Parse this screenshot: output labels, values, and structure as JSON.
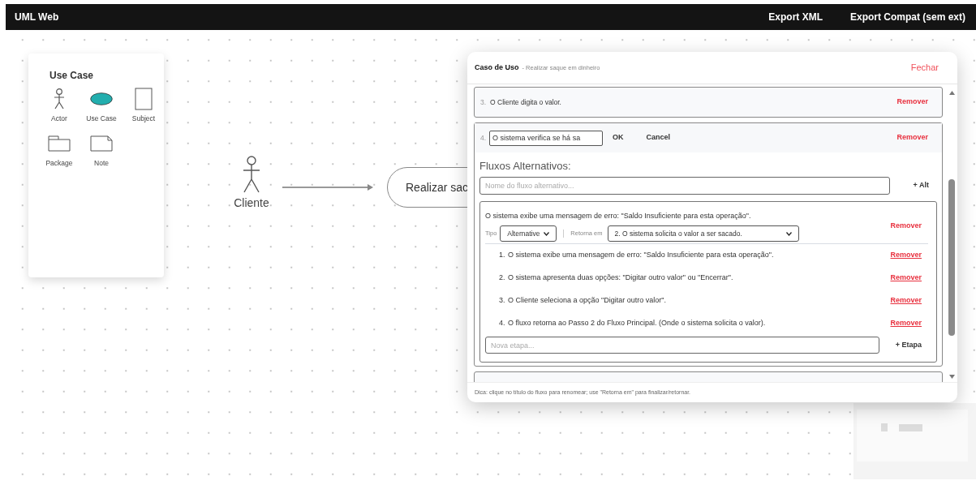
{
  "app": {
    "title": "UML Web",
    "actions": [
      "Export XML",
      "Export Compat (sem ext)"
    ]
  },
  "palette": {
    "title": "Use Case",
    "tools": [
      {
        "kind": "actor",
        "label": "Actor"
      },
      {
        "kind": "usecase",
        "label": "Use Case"
      },
      {
        "kind": "subject",
        "label": "Subject"
      },
      {
        "kind": "package",
        "label": "Package"
      },
      {
        "kind": "note",
        "label": "Note"
      }
    ]
  },
  "diagram": {
    "actor": {
      "label": "Cliente"
    },
    "use_case": {
      "label": "Realizar sac"
    }
  },
  "dialog": {
    "title": "Caso de Uso",
    "subtitle": "- Realizar saque em dinheiro",
    "close": "Fechar",
    "steps": [
      {
        "kind": "text",
        "number": "3.",
        "text": "O Cliente digita o valor.",
        "remove": "Remover"
      },
      {
        "kind": "edit",
        "number": "4.",
        "value": "O sistema verifica se há sa",
        "ok": "OK",
        "cancel": "Cancel",
        "remove": "Remover"
      }
    ],
    "alt_heading": "Fluxos Alternativos:",
    "alt_input": {
      "placeholder": "Nome do fluxo alternativo..."
    },
    "add_alt": "+ Alt",
    "alt_flows": [
      {
        "title": "O sistema exibe uma mensagem de erro: \"Saldo Insuficiente para esta operação\".",
        "remove": "Remover",
        "type_label": "Tipo",
        "type": "Alternative",
        "returns_label": "Retorna em",
        "returns": "2. O sistema solicita o valor a ser sacado.",
        "steps": [
          {
            "number": "1.",
            "text": "O sistema exibe uma mensagem de erro: \"Saldo Insuficiente para esta operação\".",
            "remove": "Remover"
          },
          {
            "number": "2.",
            "text": "O sistema apresenta duas opções: \"Digitar outro valor\" ou \"Encerrar\".",
            "remove": "Remover"
          },
          {
            "number": "3.",
            "text": "O Cliente seleciona a opção \"Digitar outro valor\".",
            "remove": "Remover"
          },
          {
            "number": "4.",
            "text": "O fluxo retorna ao Passo 2 do Fluxo Principal. (Onde o sistema solicita o valor).",
            "remove": "Remover"
          }
        ],
        "new_step": {
          "placeholder": "Nova etapa..."
        },
        "add_step": "+ Etapa"
      }
    ],
    "hint": "Dica: clique no título do fluxo para renomear; use \"Retorna em\" para finalizar/retornar."
  }
}
